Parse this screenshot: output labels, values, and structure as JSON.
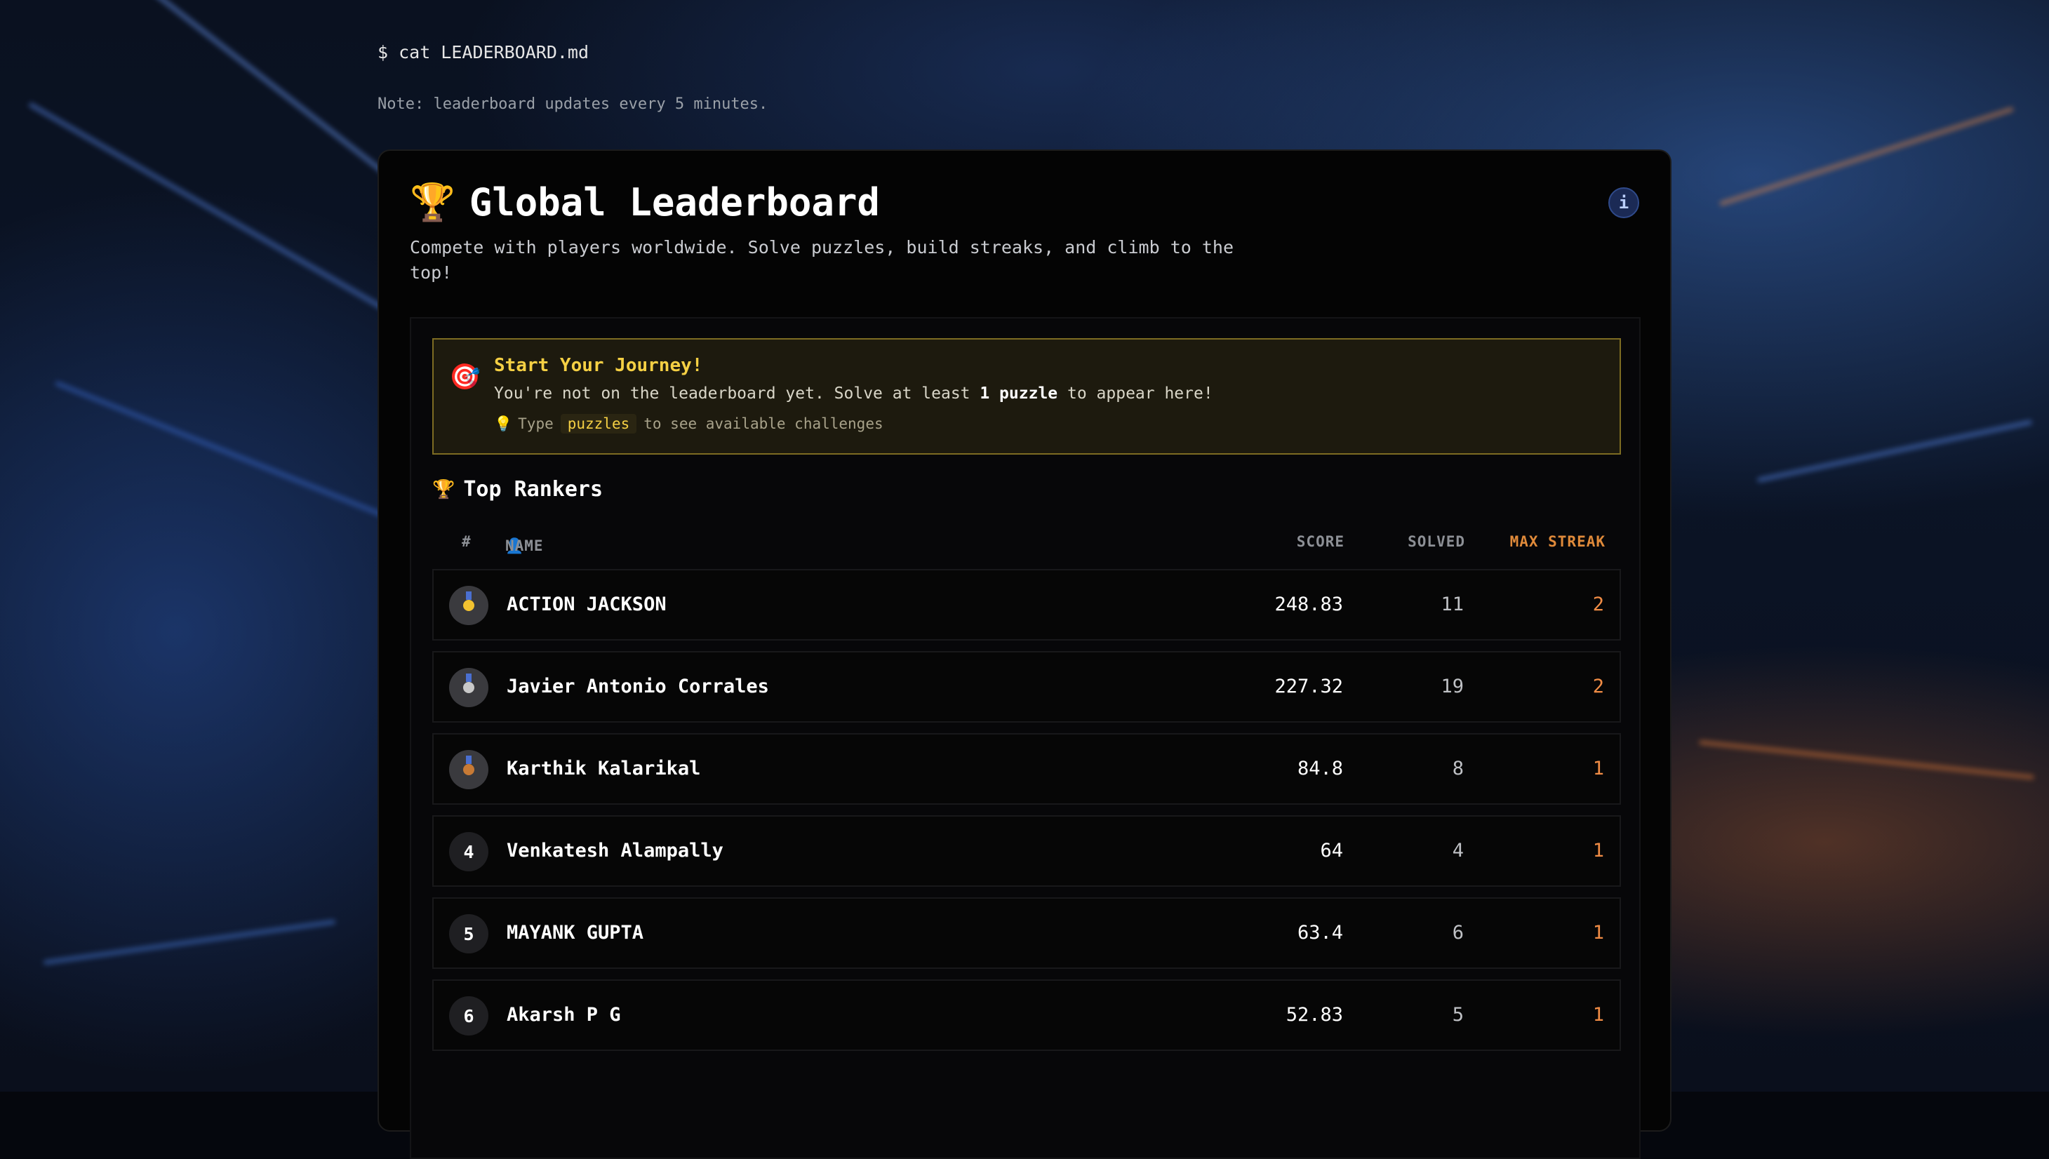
{
  "terminal": {
    "command": "$ cat LEADERBOARD.md",
    "note": "Note: leaderboard updates every 5 minutes."
  },
  "card": {
    "trophy_icon": "🏆",
    "title": "Global Leaderboard",
    "info_label": "i",
    "subtitle": "Compete with players worldwide. Solve puzzles, build streaks, and climb to the top!"
  },
  "journey": {
    "icon": "🎯",
    "title": "Start Your Journey!",
    "text_before": "You're not on the leaderboard yet. Solve at least ",
    "text_bold": "1 puzzle",
    "text_after": " to appear here!",
    "hint_icon": "💡",
    "hint_prefix": "Type",
    "hint_code": "puzzles",
    "hint_suffix": "to see available challenges"
  },
  "rankers": {
    "icon": "🏆",
    "title": "Top Rankers",
    "headers": {
      "rank": "#",
      "name_icon": "👤",
      "name": "NAME",
      "score": "SCORE",
      "solved": "SOLVED",
      "streak": "MAX STREAK"
    },
    "rows": [
      {
        "rank": "1",
        "medal": "gold",
        "name": "ACTION JACKSON",
        "score": "248.83",
        "solved": "11",
        "streak": "2"
      },
      {
        "rank": "2",
        "medal": "silver",
        "name": "Javier Antonio Corrales",
        "score": "227.32",
        "solved": "19",
        "streak": "2"
      },
      {
        "rank": "3",
        "medal": "bronze",
        "name": "Karthik Kalarikal",
        "score": "84.8",
        "solved": "8",
        "streak": "1"
      },
      {
        "rank": "4",
        "medal": "",
        "name": "Venkatesh Alampally",
        "score": "64",
        "solved": "4",
        "streak": "1"
      },
      {
        "rank": "5",
        "medal": "",
        "name": "MAYANK GUPTA",
        "score": "63.4",
        "solved": "6",
        "streak": "1"
      },
      {
        "rank": "6",
        "medal": "",
        "name": "Akarsh P G",
        "score": "52.83",
        "solved": "5",
        "streak": "1"
      }
    ]
  },
  "colors": {
    "accent_yellow": "#f5d044",
    "streak_orange": "#f08c45",
    "info_blue": "#1b2a55"
  }
}
